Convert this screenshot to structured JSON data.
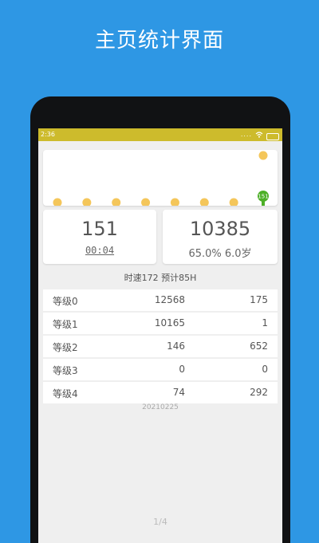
{
  "headline": "主页统计界面",
  "status_bar": {
    "time": "2:36",
    "signal": "....",
    "icons": [
      "signal-icon",
      "wifi-icon",
      "battery-icon"
    ]
  },
  "chart_data": {
    "type": "scatter",
    "points": [
      {
        "x": 1,
        "y": 0
      },
      {
        "x": 2,
        "y": 0
      },
      {
        "x": 3,
        "y": 0
      },
      {
        "x": 4,
        "y": 0
      },
      {
        "x": 5,
        "y": 0
      },
      {
        "x": 6,
        "y": 0
      },
      {
        "x": 7,
        "y": 0
      },
      {
        "x": 8,
        "y": 1
      }
    ],
    "marker_label": "151",
    "colors": {
      "dots": "#f4c65a",
      "marker": "#4caf27"
    }
  },
  "stats": {
    "left": {
      "value": "151",
      "timer": "00:04"
    },
    "right": {
      "value": "10385",
      "detail": "65.0% 6.0岁"
    }
  },
  "speed_line": "时速172 预计85H",
  "table": {
    "rows": [
      {
        "level": "等级0",
        "a": "12568",
        "b": "175"
      },
      {
        "level": "等级1",
        "a": "10165",
        "b": "1"
      },
      {
        "level": "等级2",
        "a": "146",
        "b": "652"
      },
      {
        "level": "等级3",
        "a": "0",
        "b": "0"
      },
      {
        "level": "等级4",
        "a": "74",
        "b": "292"
      }
    ]
  },
  "date": "20210225",
  "pager": "1/4",
  "colors": {
    "background": "#2e97e4",
    "status_bar": "#cdbb2c",
    "screen": "#efefef"
  }
}
